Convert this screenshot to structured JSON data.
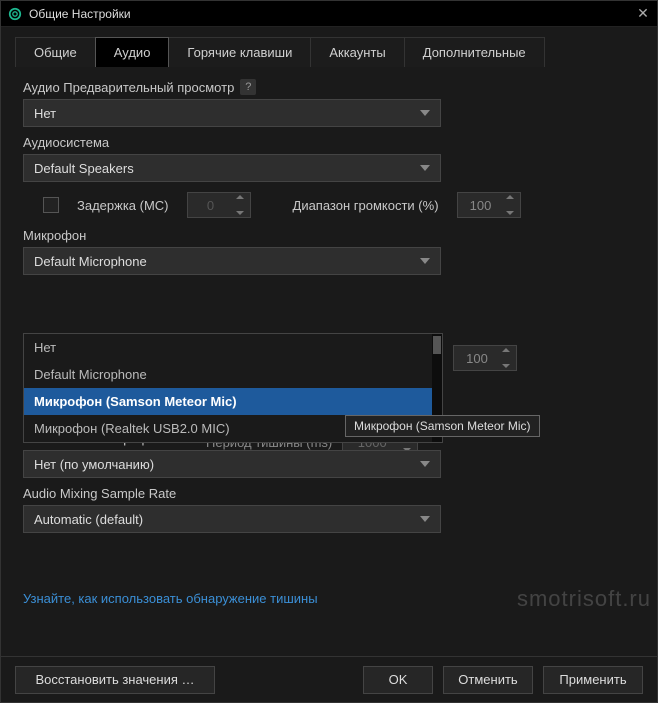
{
  "window": {
    "title": "Общие Настройки"
  },
  "tabs": {
    "items": [
      {
        "label": "Общие"
      },
      {
        "label": "Аудио"
      },
      {
        "label": "Горячие клавиши"
      },
      {
        "label": "Аккаунты"
      },
      {
        "label": "Дополнительные"
      }
    ],
    "active": 1
  },
  "fields": {
    "preview": {
      "label": "Аудио Предварительный просмотр",
      "value": "Нет"
    },
    "audiosystem": {
      "label": "Аудиосистема",
      "value": "Default Speakers"
    },
    "delay": {
      "label": "Задержка (МС)",
      "value": "0"
    },
    "volrange": {
      "label": "Диапазон громкости (%)",
      "value": "100"
    },
    "mic": {
      "label": "Микрофон",
      "value": "Default Microphone",
      "options": [
        "Нет",
        "Default Microphone",
        "Микрофон (Samson Meteor Mic)",
        "Микрофон (Realtek USB2.0 MIC)"
      ],
      "highlighted": 2
    },
    "micvol": {
      "value": "100"
    },
    "silence": {
      "label": "Период тишины (ms)",
      "value": "1000"
    },
    "monomix": {
      "label": "Микс с моно микрофона",
      "value": "Нет (по умолчанию)"
    },
    "samplerate": {
      "label": "Audio Mixing Sample Rate",
      "value": "Automatic (default)"
    }
  },
  "tooltip": "Микрофон (Samson Meteor Mic)",
  "link": "Узнайте, как использовать обнаружение тишины",
  "buttons": {
    "restore": "Восстановить значения …",
    "ok": "OK",
    "cancel": "Отменить",
    "apply": "Применить"
  },
  "watermark": "smotrisoft.ru"
}
